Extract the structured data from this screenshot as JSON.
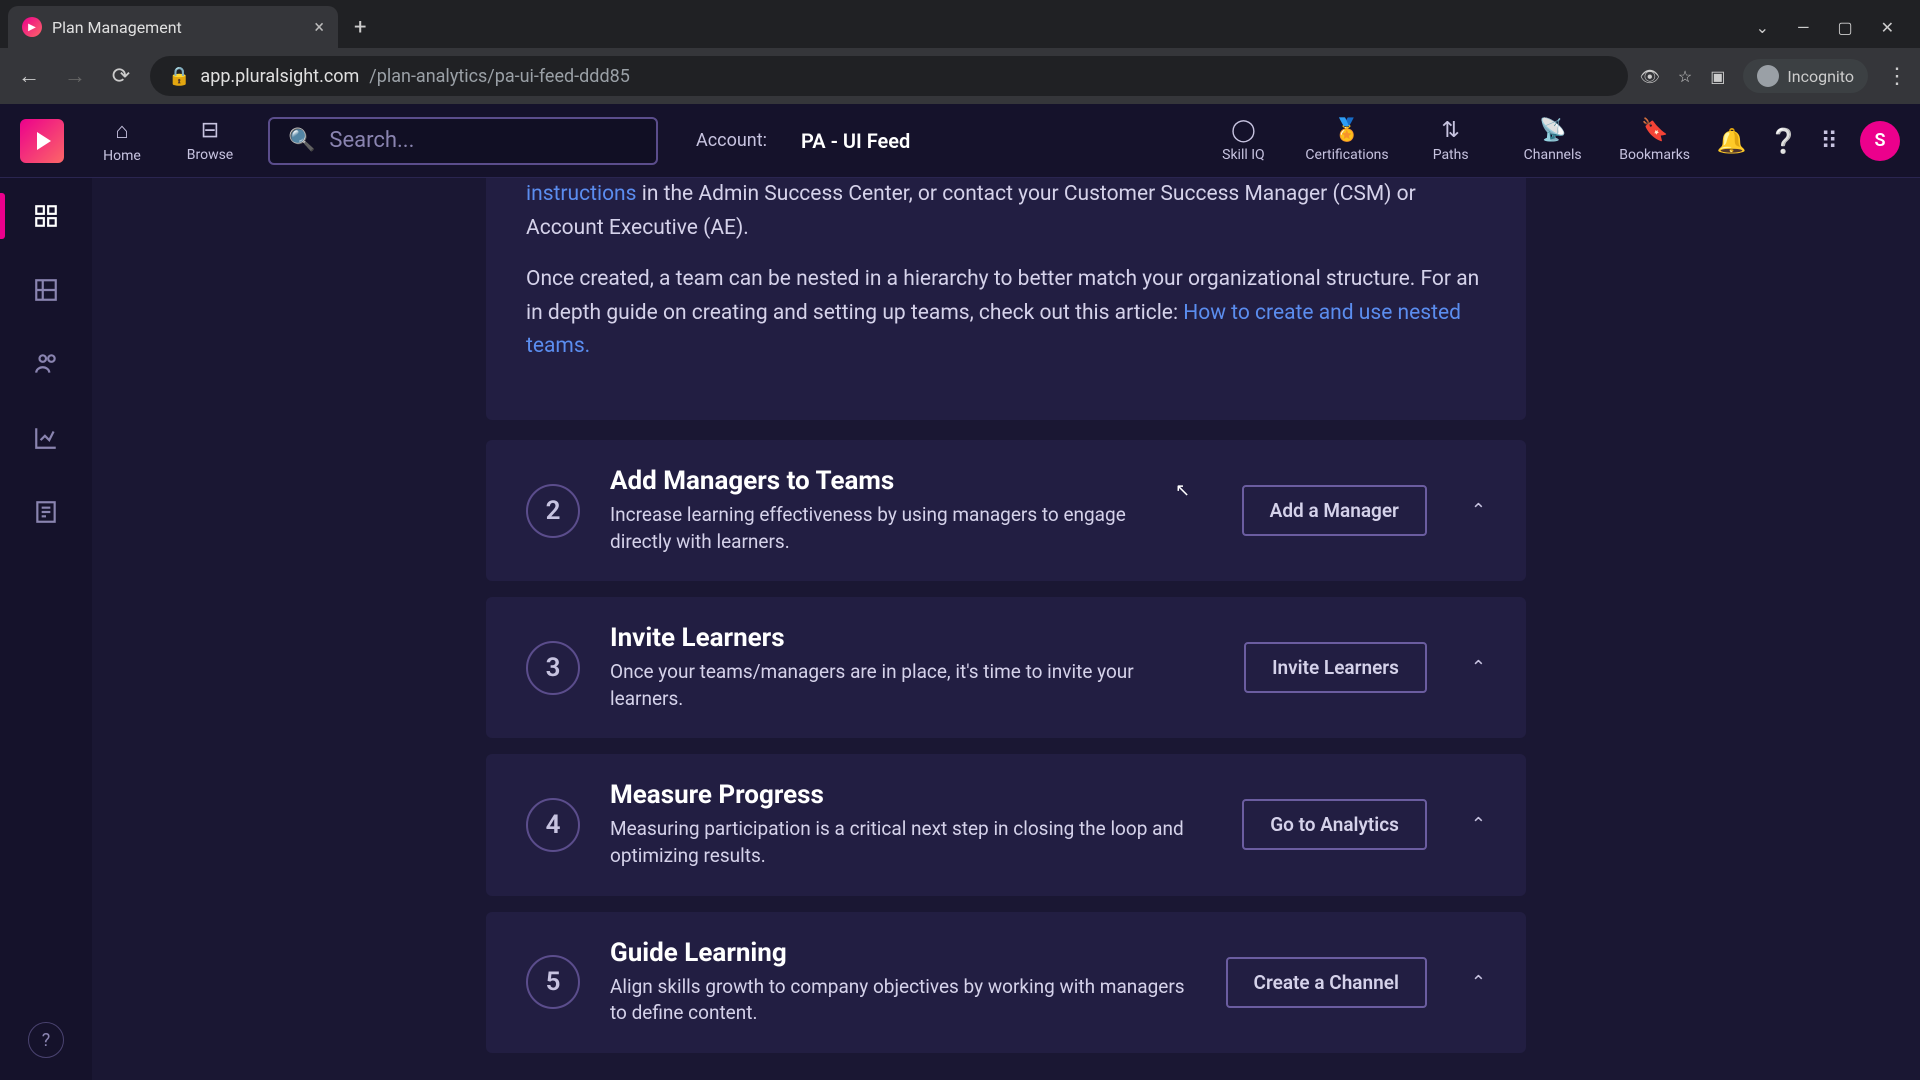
{
  "browser": {
    "tab_title": "Plan Management",
    "url_host": "app.pluralsight.com",
    "url_path": "/plan-analytics/pa-ui-feed-ddd85",
    "incognito_label": "Incognito"
  },
  "header": {
    "nav": {
      "home": "Home",
      "browse": "Browse"
    },
    "search_placeholder": "Search...",
    "account_label": "Account:",
    "account_name": "PA - UI Feed",
    "right_nav": {
      "skill_iq": "Skill IQ",
      "certifications": "Certifications",
      "paths": "Paths",
      "channels": "Channels",
      "bookmarks": "Bookmarks"
    },
    "avatar_initial": "S"
  },
  "intro": {
    "link_instructions": "instructions",
    "para1_tail": " in the Admin Success Center, or contact your Customer Success Manager (CSM) or Account Executive (AE).",
    "para2_pre": "Once created, a team can be nested in a hierarchy to better match your organizational structure. For an in depth guide on creating and setting up teams, check out this article: ",
    "link_nested": "How to create and use nested teams."
  },
  "steps": [
    {
      "num": "2",
      "title": "Add Managers to Teams",
      "desc": "Increase learning effectiveness by using managers to engage directly with learners.",
      "button": "Add a Manager"
    },
    {
      "num": "3",
      "title": "Invite Learners",
      "desc": "Once your teams/managers are in place, it's time to invite your learners.",
      "button": "Invite Learners"
    },
    {
      "num": "4",
      "title": "Measure Progress",
      "desc": "Measuring participation is a critical next step in closing the loop and optimizing results.",
      "button": "Go to Analytics"
    },
    {
      "num": "5",
      "title": "Guide Learning",
      "desc": "Align skills growth to company objectives by working with managers to define content.",
      "button": "Create a Channel"
    }
  ]
}
